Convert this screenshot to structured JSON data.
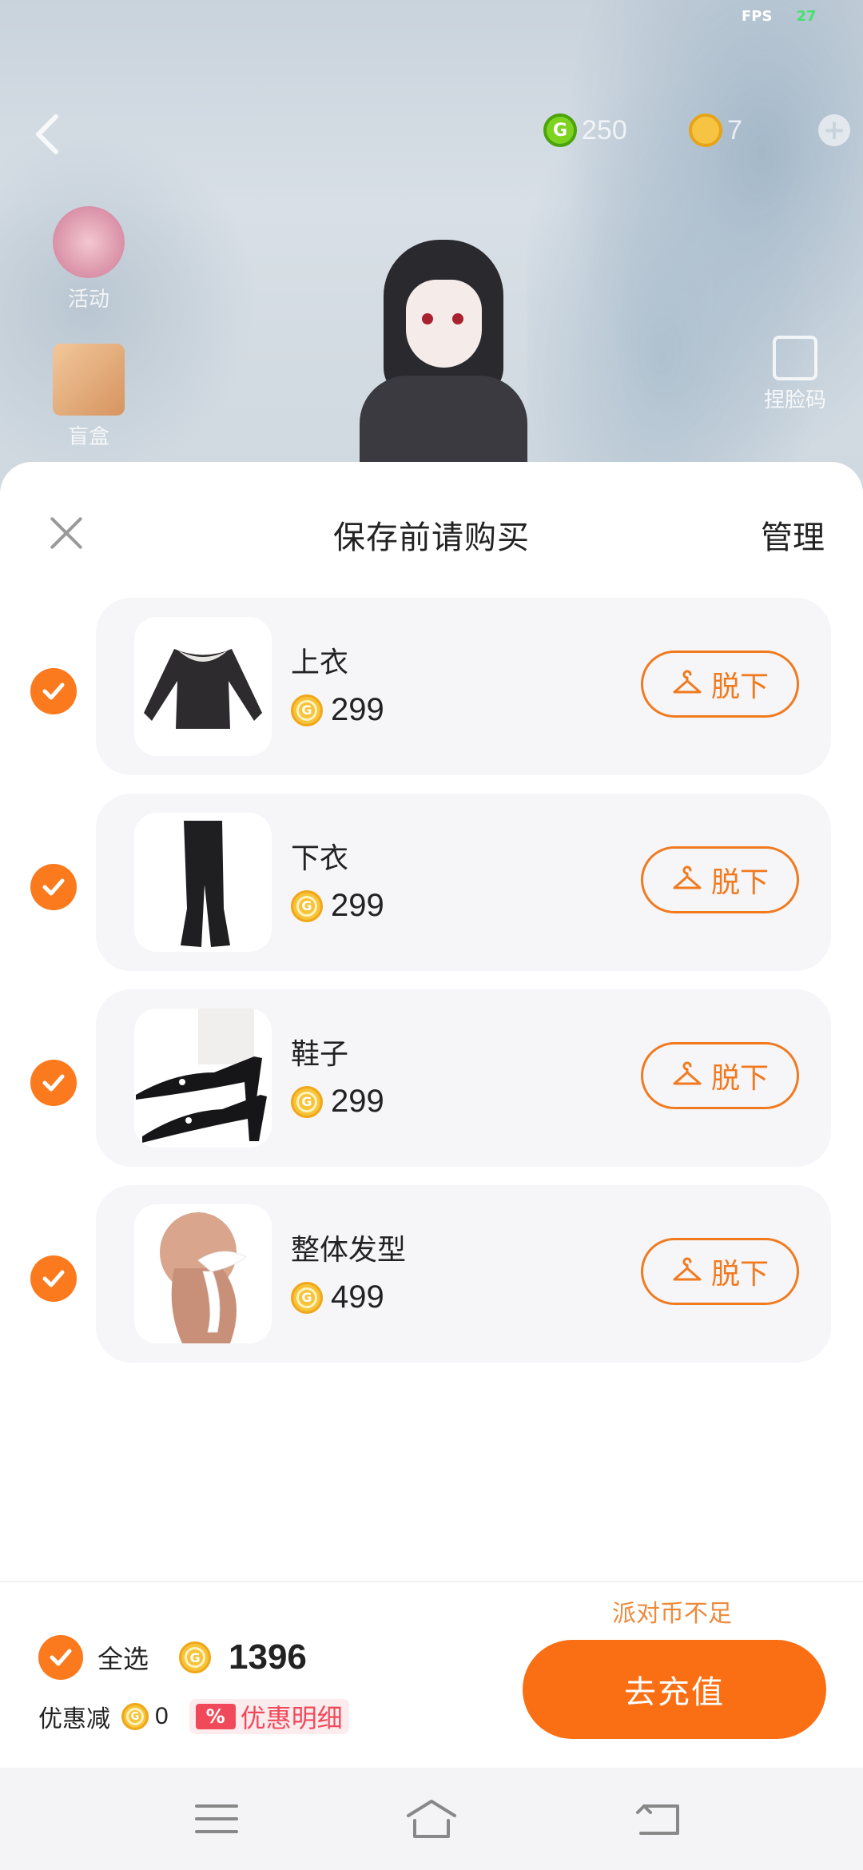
{
  "status": {
    "fps_label": "FPS",
    "fps_value": "27"
  },
  "top_bar": {
    "green_currency": "250",
    "yellow_currency": "7",
    "add_symbol": "+"
  },
  "side_menu": {
    "activity_label": "活动",
    "blindbox_label": "盲盒",
    "face_code_label": "捏脸码"
  },
  "sheet": {
    "title": "保存前请购买",
    "manage_label": "管理",
    "items": [
      {
        "name": "上衣",
        "price": "299",
        "action": "脱下"
      },
      {
        "name": "下衣",
        "price": "299",
        "action": "脱下"
      },
      {
        "name": "鞋子",
        "price": "299",
        "action": "脱下"
      },
      {
        "name": "整体发型",
        "price": "499",
        "action": "脱下"
      }
    ]
  },
  "footer": {
    "insufficient_text": "派对币不足",
    "select_all_label": "全选",
    "total": "1396",
    "discount_label": "优惠减",
    "discount_value": "0",
    "discount_badge": "%",
    "discount_detail": "优惠明细",
    "recharge_label": "去充值"
  },
  "colors": {
    "accent_orange": "#fb6f14",
    "button_border": "#f17a1f",
    "coin_yellow": "#f7c33a",
    "discount_red": "#f04a5a"
  }
}
